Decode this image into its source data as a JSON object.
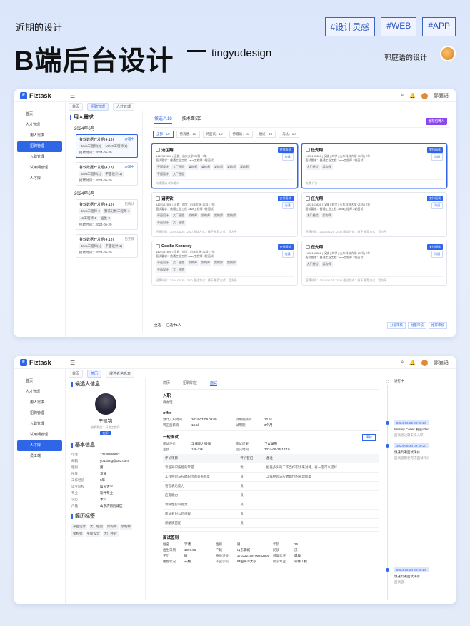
{
  "header": {
    "subtitle": "近期的设计",
    "title": "B端后台设计",
    "byline": "tingyudesign",
    "tags": [
      "#设计灵感",
      "#WEB",
      "#APP"
    ],
    "author": "郭庭语的设计"
  },
  "app": {
    "logo": "Fiztask",
    "user": "郭庭语"
  },
  "p1": {
    "tabs": [
      "首页",
      "招聘管理",
      "人才管理"
    ],
    "side": [
      {
        "label": "首页"
      },
      {
        "label": "人才管理"
      },
      {
        "label": "用人需求"
      },
      {
        "label": "招聘管理"
      },
      {
        "label": "入职管理"
      },
      {
        "label": "试用期管理"
      },
      {
        "label": "人才库"
      }
    ],
    "left_title": "用人需求",
    "months": [
      "2024年6月",
      "2024年6月"
    ],
    "reqs": [
      {
        "title": "鲁软数据开发组(4,13)",
        "status": "办理中",
        "tags": [
          "Java工程师(2)",
          "UI/UX工程师(1)"
        ],
        "foot": "招聘时间：2024-06-20"
      },
      {
        "title": "鲁软数据开发组(4,13)",
        "status": "办理中",
        "tags": [
          "Java工程师(1)",
          "平面设计(1)"
        ],
        "foot": "招聘时间：2024-06-20"
      },
      {
        "title": "鲁软数据开发组(4,13)",
        "status": "已确认",
        "tags": [
          "Java工程师-2",
          "算法分析工程师-1",
          "UI工程师-1",
          "运维-2"
        ],
        "foot": "招聘时间：2024-06-20"
      },
      {
        "title": "鲁软数据开发组(4,13)",
        "status": "已完成",
        "tags": [
          "Java工程师(1)",
          "平面设计(1)"
        ],
        "foot": "招聘时间：2024-06-20"
      }
    ],
    "ctabs": [
      "候选人18",
      "技术面试5"
    ],
    "pill": "推荐招聘人",
    "filters": [
      "全部：10",
      "待沟通：10",
      "待面试：10",
      "待邀请：10",
      "通过：10",
      "淘汰：10"
    ],
    "cards": [
      {
        "name": "汤芷翔",
        "line1": "1422167826 | 汉族 | 山东大学·本科 | 7年",
        "line2": "面试要求：普通工业工程 Java工程师 2轮面试",
        "tags": [
          "平面设计",
          "大厂经验",
          "架构师",
          "架构师",
          "架构师",
          "架构师",
          "架构师",
          "平面设计",
          "大厂经验"
        ],
        "foot": "沟通邀请   发布意向"
      },
      {
        "name": "任先翔",
        "line1": "1422167826 | 汉族 | 刘学 | 山东科技大学·本科 | 7年",
        "line2": "面试要求：普通工业工程 Java工程师 2轮面试",
        "tags": [
          "大厂经验",
          "架构师"
        ],
        "foot": "沟通   评价"
      },
      {
        "name": "诸明钦",
        "line1": "1422167826 | 汉族 | 刘学 | 山东大学·本科 | 7年",
        "line2": "面试要求：普通工业工程 Java工程师 2轮面试",
        "tags": [
          "平面设计",
          "大厂经验",
          "架构师",
          "架构师",
          "架构师",
          "架构师",
          "平面设计",
          "大厂经验"
        ],
        "foot": "招聘时间：2024-06-25 12:00   面试方式：线下   推荐方式：官方平"
      },
      {
        "name": "任先翔",
        "line1": "1422167826 | 汉族 | 刘学 | 山东科技大学·本科 | 7年",
        "line2": "面试要求：普通工业工程 Java工程师 2轮面试",
        "tags": [
          "大厂经验",
          "架构师"
        ],
        "foot": "招聘时间：2024-06-25 12:00   面试方式：线下   推荐方式：官方平"
      },
      {
        "name": "Cecilia Kennedy",
        "line1": "1422167826 | 汉族 | 刘学 | 山东大学·本科 | 7年",
        "line2": "面试要求：普通工业工程 Java工程师 2轮面试",
        "tags": [
          "平面设计",
          "大厂经验",
          "架构师",
          "架构师",
          "架构师",
          "架构师",
          "平面设计",
          "大厂经验"
        ],
        "foot": "招聘时间：2024-06-25 12:00   面试方式：线下   推荐方式：官方平"
      },
      {
        "name": "任先翔",
        "line1": "1422167826 | 汉族 | 刘学 | 山东科技大学·本科 | 7年",
        "line2": "面试要求：普通工业工程 Java工程师 2轮面试",
        "tags": [
          "大厂经验",
          "架构师"
        ],
        "foot": "招聘时间：2024-06-25 12:00   面试方式：线下   推荐方式：官方平"
      }
    ],
    "card_btn1": "安排面试",
    "card_btn2": "沟通",
    "bottom": {
      "all": "全选",
      "selected": "已选中1人",
      "actions": [
        "分配审核",
        "批量审核",
        "推荐审核"
      ]
    }
  },
  "p2": {
    "tabs": [
      "首页",
      "简历",
      "候选者信息表"
    ],
    "side": [
      {
        "label": "首页"
      },
      {
        "label": "人才管理"
      },
      {
        "label": "用人需求"
      },
      {
        "label": "招聘管理"
      },
      {
        "label": "入职管理"
      },
      {
        "label": "试用期管理"
      },
      {
        "label": "人才库"
      },
      {
        "label": "员工端"
      }
    ],
    "title": "候选人信息",
    "name": "于建锦",
    "role": "应聘职位：开发工程师",
    "badge": "在职",
    "basic_title": "基本信息",
    "basic": [
      [
        "电话",
        "13526699652"
      ],
      [
        "邮箱",
        "youxiang@163.com"
      ],
      [
        "性别",
        "男"
      ],
      [
        "民族",
        "汉族"
      ],
      [
        "工作经验",
        "5年"
      ],
      [
        "毕业院校",
        "山东大学"
      ],
      [
        "专业",
        "软件专业"
      ],
      [
        "学历",
        "本科"
      ],
      [
        "户籍",
        "山东济南历城区"
      ]
    ],
    "tag_title": "简历标签",
    "ptags": [
      "平面设计",
      "大厂经验",
      "架构师",
      "架构师",
      "架构师",
      "平面设计",
      "大厂经验"
    ],
    "mtabs": [
      "简历",
      "招聘职位",
      "面试"
    ],
    "entry": {
      "h": "入职",
      "v": "待办理"
    },
    "offer": {
      "h": "offer",
      "rows": [
        [
          "预计入职时间",
          "2024-07-09 09:00",
          "试用期薪资",
          "12.5k"
        ],
        [
          "转正后薪资",
          "13.5k",
          "试用期",
          "3个月"
        ]
      ]
    },
    "first": {
      "h": "一轮面试",
      "btn": "评价",
      "rows": [
        [
          "面试评价",
          "工作能力很强",
          "面试结果",
          "予以录用"
        ],
        [
          "定薪",
          "12k-13k",
          "提交时间",
          "2024-06-25 10:10"
        ]
      ]
    },
    "table": {
      "headers": [
        "评价项目",
        "评价登记",
        "备注"
      ],
      "rows": [
        [
          "专业知识技能的掌握",
          "优",
          "担任多头的工作当作职场来对待，有一定可以提好"
        ],
        [
          "工作经验与应聘职位的关系程度",
          "良",
          "工作经验与应聘职位的管理程度"
        ],
        [
          "语言表达能力",
          "良",
          ""
        ],
        [
          "应变能力",
          "良",
          ""
        ],
        [
          "领域性影响能力",
          "良",
          ""
        ],
        [
          "面试者对公司感观",
          "良",
          ""
        ],
        [
          "薪酬质匹配",
          "良",
          ""
        ]
      ]
    },
    "sign": {
      "h": "面试签到",
      "rows": [
        [
          "姓名",
          "李诸",
          "性别",
          "男",
          "年龄",
          "26"
        ],
        [
          "出生日期",
          "1997.06",
          "户籍",
          "山东聊城",
          "民族",
          "汉"
        ],
        [
          "学历",
          "硕士",
          "身份证号",
          "370322199706252805",
          "健康状况",
          "健康"
        ],
        [
          "婚姻状况",
          "未婚",
          "毕业学校",
          "中国海洋大学",
          "所学专业",
          "软件工程"
        ]
      ]
    },
    "timeline": [
      {
        "date": "进行中",
        "t1": "",
        "t2": ""
      },
      {
        "date": "2024-06-25 09:20:20",
        "t1": "Wesley Collier 发送offer",
        "t2": "面试通过需安排入职"
      },
      {
        "date": "2024-06-24 09:20:20",
        "t1": "慎逢兵邀面试评价",
        "t2": "面试官需要完成面试评价"
      },
      {
        "date": "2024-06-24 09:20:20",
        "t1": "慎逢兵邀面试评价",
        "t2": "面试官"
      }
    ]
  }
}
